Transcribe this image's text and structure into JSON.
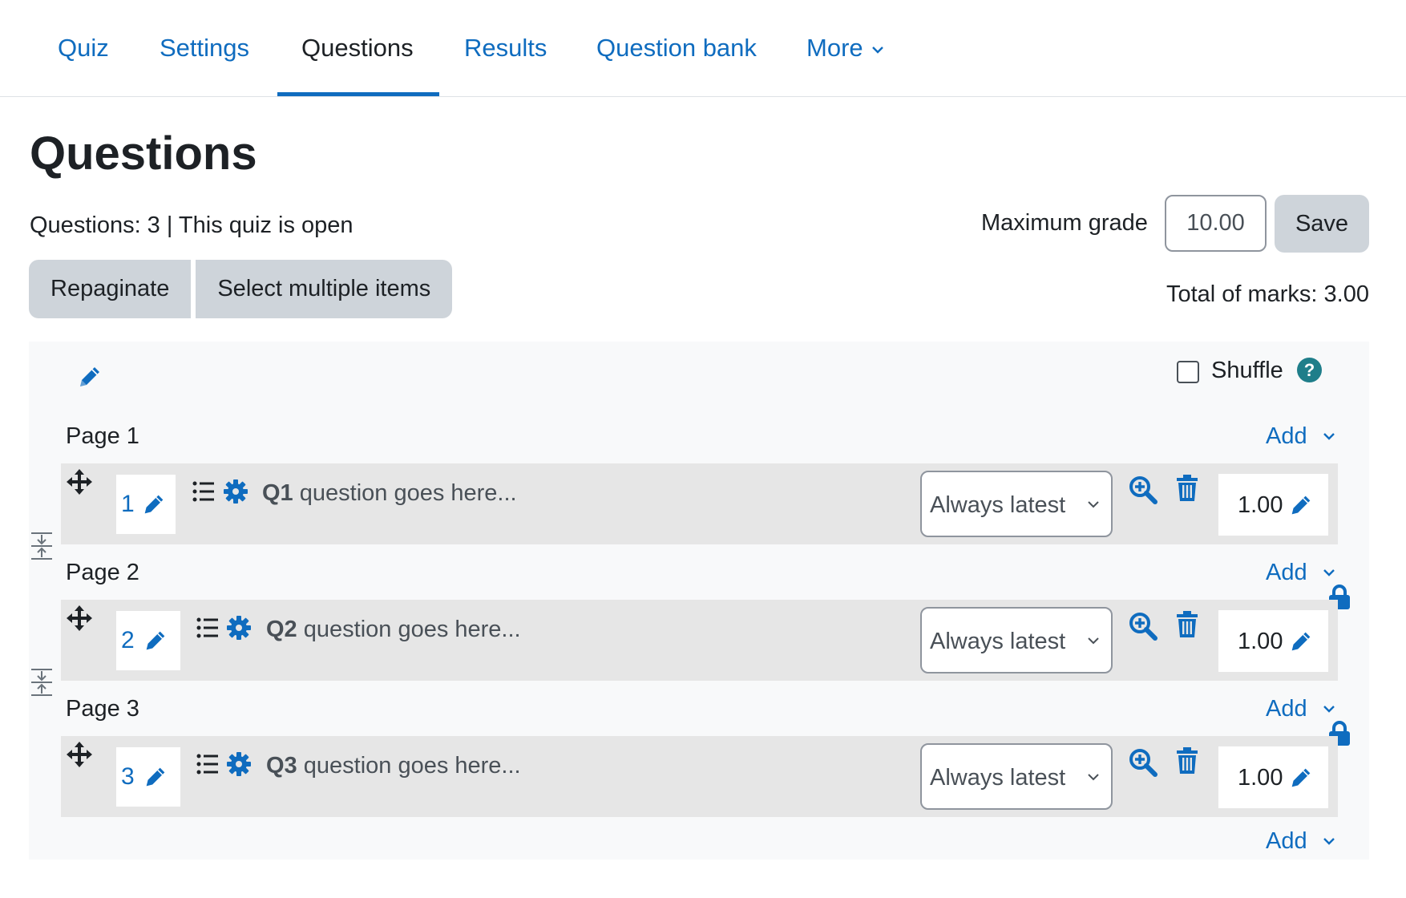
{
  "nav": {
    "tabs": [
      {
        "label": "Quiz"
      },
      {
        "label": "Settings"
      },
      {
        "label": "Questions"
      },
      {
        "label": "Results"
      },
      {
        "label": "Question bank"
      },
      {
        "label": "More"
      }
    ],
    "active": "Questions"
  },
  "page_title": "Questions",
  "info_text": "Questions: 3 | This quiz is open",
  "buttons": {
    "repaginate": "Repaginate",
    "select_multiple": "Select multiple items",
    "save": "Save"
  },
  "max_grade": {
    "label": "Maximum grade",
    "value": "10.00"
  },
  "total_marks": "Total of marks: 3.00",
  "section": {
    "shuffle_label": "Shuffle",
    "help_glyph": "?",
    "add_label": "Add"
  },
  "pages": [
    {
      "label": "Page 1",
      "add": "Add",
      "question": {
        "number": "1",
        "name": "Q1",
        "text": "question goes here...",
        "version": "Always latest",
        "mark": "1.00"
      }
    },
    {
      "label": "Page 2",
      "add": "Add",
      "question": {
        "number": "2",
        "name": "Q2",
        "text": "question goes here...",
        "version": "Always latest",
        "mark": "1.00"
      }
    },
    {
      "label": "Page 3",
      "add": "Add",
      "question": {
        "number": "3",
        "name": "Q3",
        "text": "question goes here...",
        "version": "Always latest",
        "mark": "1.00"
      }
    }
  ],
  "final_add": "Add",
  "colors": {
    "link": "#0f6cbf",
    "text": "#1d2125",
    "muted": "#495057",
    "button_bg": "#ced4da",
    "section_bg": "#f8f9fa",
    "slot_bg": "#e6e6e6",
    "help_bg": "#1f7e8a"
  },
  "icons": [
    "pencil-icon",
    "move-icon",
    "list-icon",
    "gear-icon",
    "zoom-in-icon",
    "trash-icon",
    "lock-icon",
    "page-break-icon",
    "chevron-down-icon",
    "help-icon"
  ]
}
